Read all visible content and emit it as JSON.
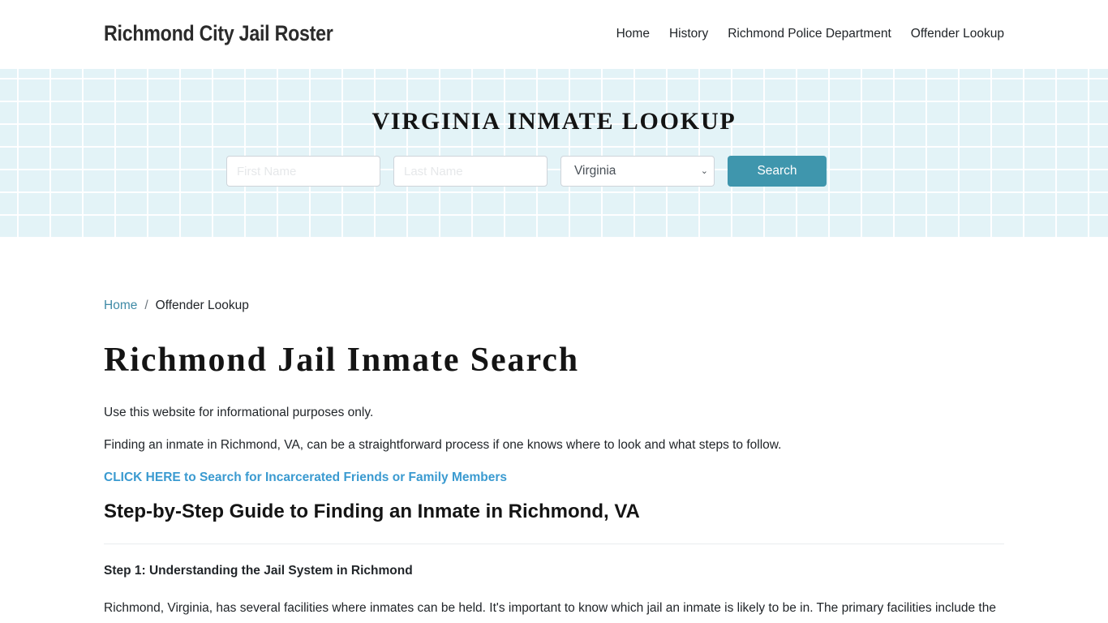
{
  "header": {
    "brand": "Richmond City Jail Roster",
    "nav": [
      {
        "label": "Home"
      },
      {
        "label": "History"
      },
      {
        "label": "Richmond Police Department"
      },
      {
        "label": "Offender Lookup"
      }
    ]
  },
  "hero": {
    "title": "VIRGINIA INMATE LOOKUP",
    "first_name": {
      "placeholder": "First Name",
      "value": ""
    },
    "last_name": {
      "placeholder": "Last Name",
      "value": ""
    },
    "state_select": {
      "selected": "Virginia"
    },
    "search_label": "Search",
    "colors": {
      "background": "#e3f3f7",
      "button": "#3f96ad"
    }
  },
  "breadcrumb": {
    "home": "Home",
    "separator": "/",
    "current": "Offender Lookup"
  },
  "content": {
    "title": "Richmond Jail Inmate Search",
    "paragraphs": [
      "Use this website for informational purposes only.",
      "Finding an inmate in Richmond, VA, can be a straightforward process if one knows where to look and what steps to follow."
    ],
    "cta_link": "CLICK HERE to Search for Incarcerated Friends or Family Members",
    "section_heading": "Step-by-Step Guide to Finding an Inmate in Richmond, VA",
    "step1_heading": "Step 1: Understanding the Jail System in Richmond",
    "step1_text": "Richmond, Virginia, has several facilities where inmates can be held. It's important to know which jail an inmate is likely to be in. The primary facilities include the",
    "colors": {
      "link": "#3a9ad0",
      "breadcrumb_link": "#3f8aa6"
    }
  }
}
